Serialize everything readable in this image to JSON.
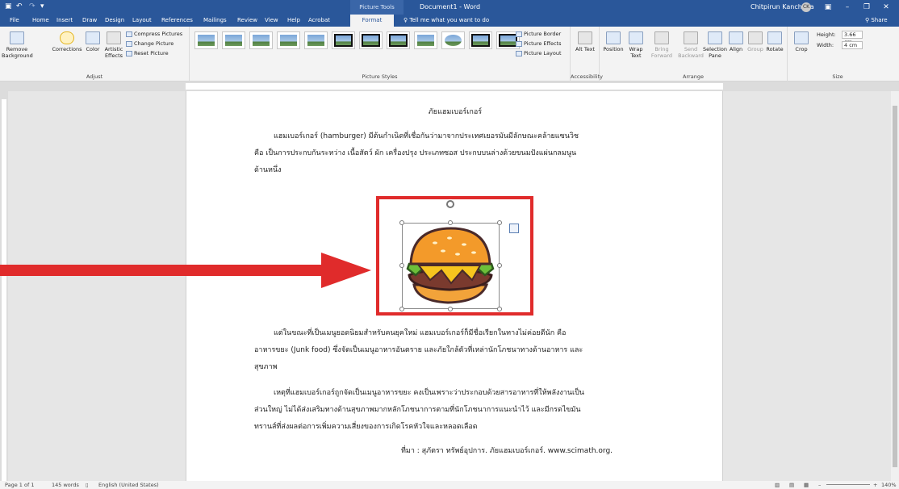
{
  "titlebar": {
    "context_tools": "Picture Tools",
    "doc_title": "Document1 - Word",
    "user_name": "Chitpirun Kanchana",
    "user_initials": "CK"
  },
  "tabs": [
    "File",
    "Home",
    "Insert",
    "Draw",
    "Design",
    "Layout",
    "References",
    "Mailings",
    "Review",
    "View",
    "Help",
    "Acrobat",
    "Format"
  ],
  "active_tab": "Format",
  "tell_me": "Tell me what you want to do",
  "share": "Share",
  "ribbon": {
    "adjust": {
      "label": "Adjust",
      "remove_bg": "Remove Background",
      "corrections": "Corrections",
      "color": "Color",
      "artistic": "Artistic Effects",
      "compress": "Compress Pictures",
      "change": "Change Picture",
      "reset": "Reset Picture"
    },
    "styles": {
      "label": "Picture Styles",
      "border": "Picture Border",
      "effects": "Picture Effects",
      "layout": "Picture Layout"
    },
    "accessibility": {
      "label": "Accessibility",
      "alt_text": "Alt Text"
    },
    "arrange": {
      "label": "Arrange",
      "position": "Position",
      "wrap": "Wrap Text",
      "forward": "Bring Forward",
      "backward": "Send Backward",
      "selection": "Selection Pane",
      "align": "Align",
      "group": "Group",
      "rotate": "Rotate"
    },
    "size": {
      "label": "Size",
      "crop": "Crop",
      "height_label": "Height:",
      "height_value": "3.66 cm",
      "width_label": "Width:",
      "width_value": "4 cm"
    }
  },
  "document": {
    "heading": "ภัยแฮมเบอร์เกอร์",
    "p1_line1": "แฮมเบอร์เกอร์ (hamburger) มีต้นกำเนิดที่เชื่อกันว่ามาจากประเทศเยอรมันมีลักษณะคล้ายแซนวิช",
    "p1_line2": "คือ เป็นการประกบกันระหว่าง เนื้อสัตว์ ผัก เครื่องปรุง ประเภทซอส ประกบบนล่างด้วยขนมปังแผ่นกลมนูน",
    "p1_line3": "ด้านหนึ่ง",
    "p2_line1": "แต่ในขณะที่เป็นเมนูยอดนิยมสำหรับคนยุคใหม่ แฮมเบอร์เกอร์ก็มีชื่อเรียกในทางไม่ค่อยดีนัก คือ",
    "p2_line2": "อาหารขยะ (Junk food) ซึ่งจัดเป็นเมนูอาหารอันตราย และภัยใกล้ตัวที่เหล่านักโภชนาทางด้านอาหาร และ",
    "p2_line3": "สุขภาพ",
    "p3_line1": "เหตุที่แฮมเบอร์เกอร์ถูกจัดเป็นเมนูอาหารขยะ คงเป็นเพราะว่าประกอบด้วยสารอาหารที่ให้พลังงานเป็น",
    "p3_line2": "ส่วนใหญ่ ไม่ได้ส่งเสริมทางด้านสุขภาพมากหลักโภชนาการตามที่นักโภชนาการแนะนำไว้ และมีกรดไขมัน",
    "p3_line3": "ทรานส์ที่ส่งผลต่อการเพิ่มความเสี่ยงของการเกิดโรคหัวใจและหลอดเลือด",
    "source": "ที่มา : สุภัตรา ทรัพย์อุปการ. ภัยแฮมเบอร์เกอร์. www.scimath.org."
  },
  "status": {
    "page": "Page 1 of 1",
    "words": "145 words",
    "language": "English (United States)",
    "zoom": "140%"
  },
  "colors": {
    "word_blue": "#2a579a",
    "highlight_red": "#e02b2b"
  }
}
